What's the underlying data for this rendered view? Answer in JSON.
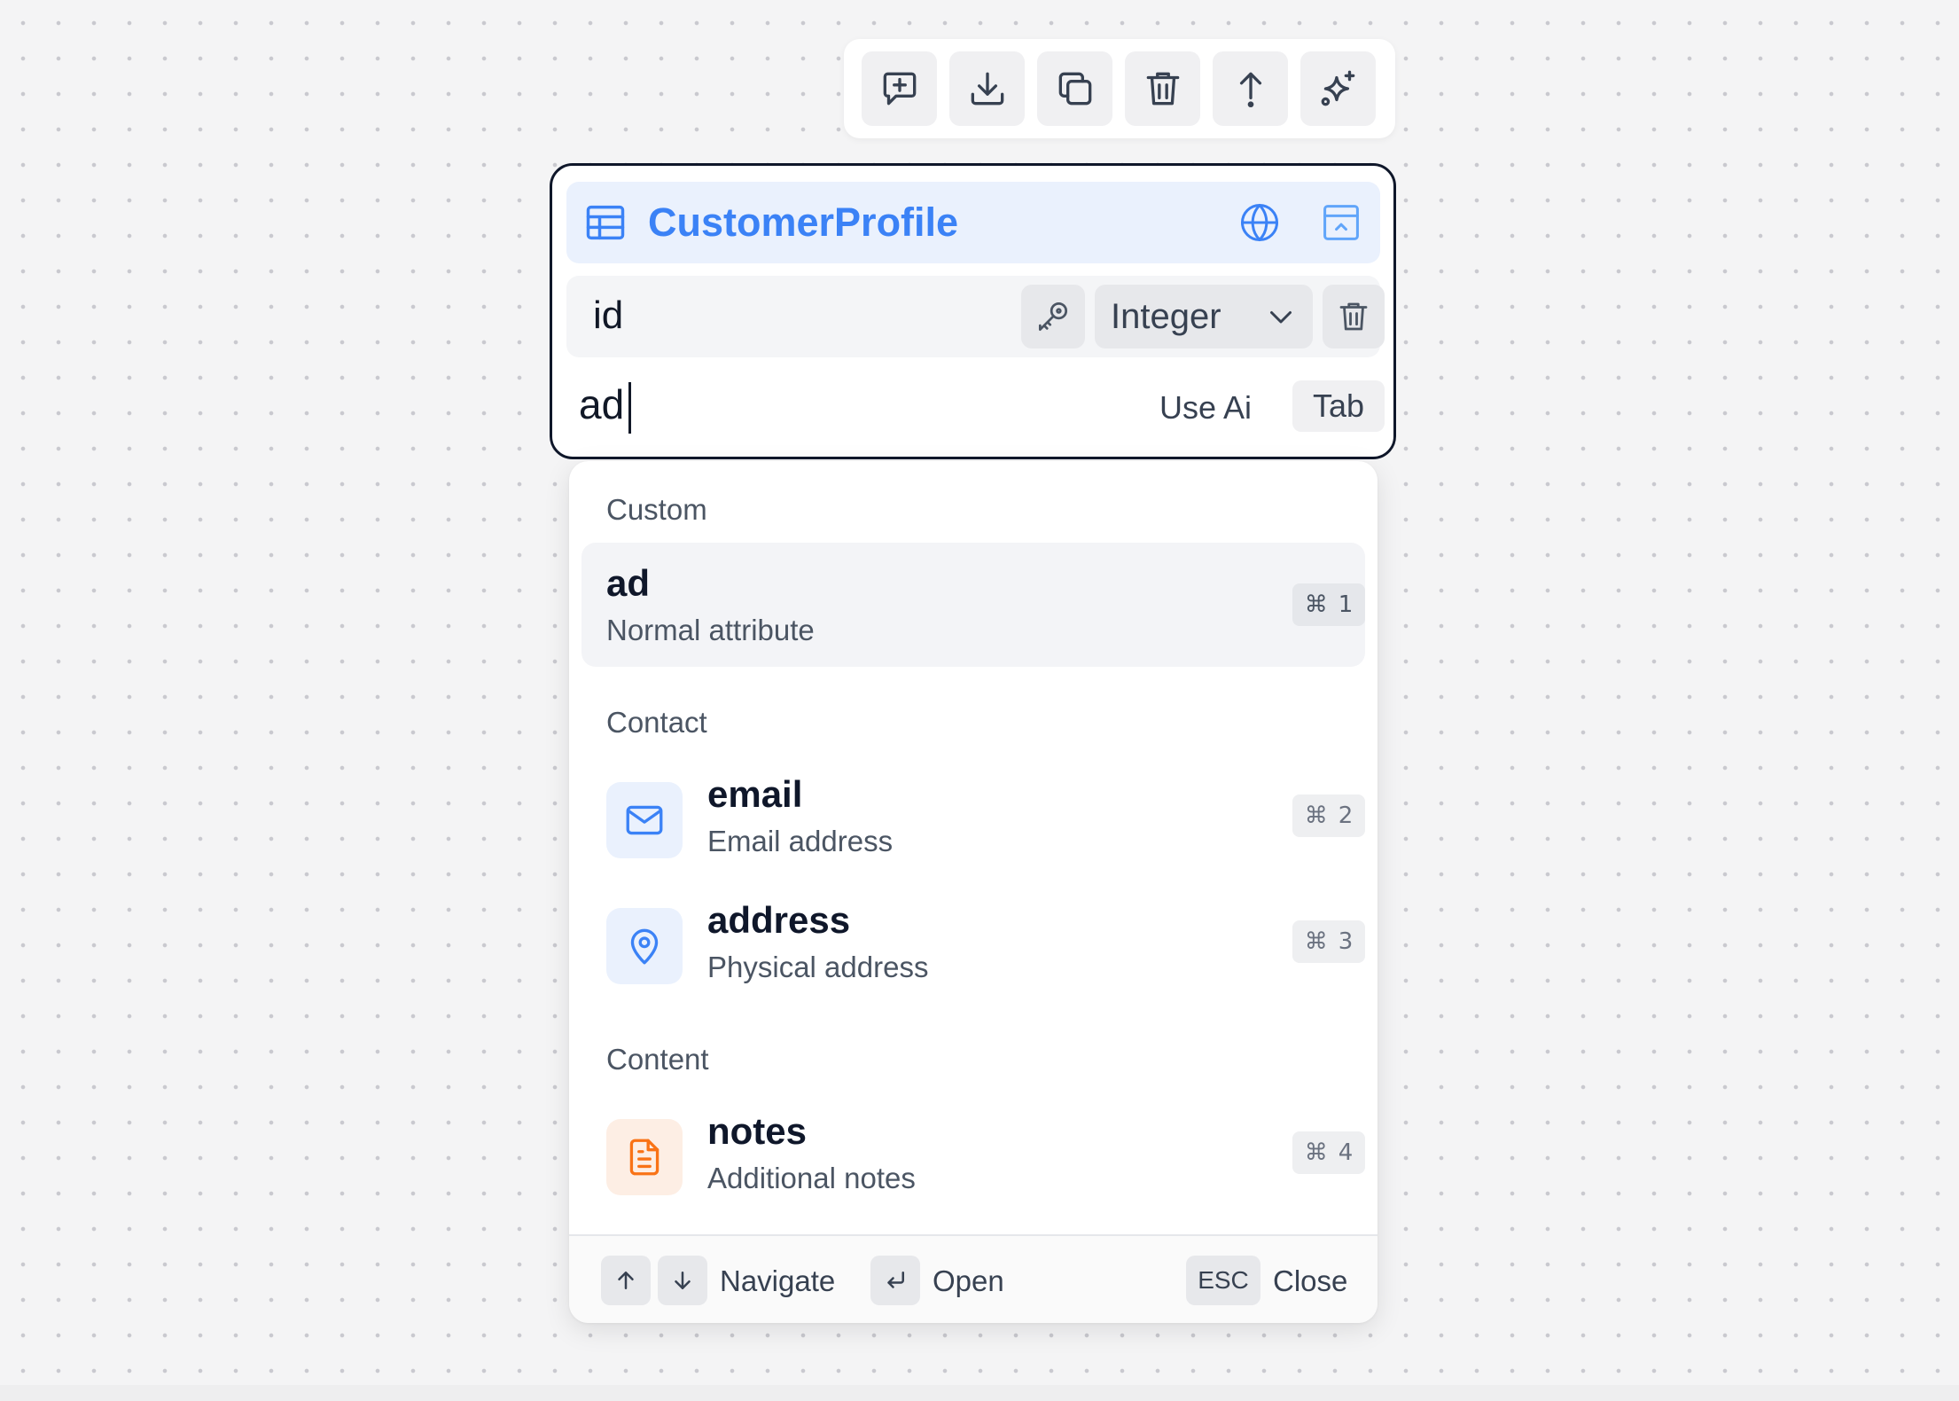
{
  "toolbar": {
    "buttons": [
      {
        "icon": "add-comment-icon"
      },
      {
        "icon": "download-icon"
      },
      {
        "icon": "copy-icon"
      },
      {
        "icon": "trash-icon"
      },
      {
        "icon": "arrow-up-icon"
      },
      {
        "icon": "sparkles-icon"
      }
    ]
  },
  "entity": {
    "title": "CustomerProfile",
    "accent_color": "#3b82f6",
    "attributes": [
      {
        "name": "id",
        "type": "Integer",
        "is_key": true
      }
    ],
    "new_attribute": {
      "value": "ad",
      "use_ai_label": "Use Ai",
      "tab_key": "Tab"
    }
  },
  "suggestions": {
    "groups": [
      {
        "label": "Custom",
        "items": [
          {
            "title": "ad",
            "subtitle": "Normal attribute",
            "shortcut_mod": "⌘",
            "shortcut_key": "1"
          }
        ]
      },
      {
        "label": "Contact",
        "items": [
          {
            "title": "email",
            "subtitle": "Email address",
            "icon": "mail-icon",
            "icon_color": "#3b82f6",
            "shortcut_mod": "⌘",
            "shortcut_key": "2"
          },
          {
            "title": "address",
            "subtitle": "Physical address",
            "icon": "map-pin-icon",
            "icon_color": "#3b82f6",
            "shortcut_mod": "⌘",
            "shortcut_key": "3"
          }
        ]
      },
      {
        "label": "Content",
        "items": [
          {
            "title": "notes",
            "subtitle": "Additional notes",
            "icon": "file-text-icon",
            "icon_color": "#f97316",
            "shortcut_mod": "⌘",
            "shortcut_key": "4"
          }
        ]
      }
    ],
    "footer": {
      "navigate_label": "Navigate",
      "open_label": "Open",
      "esc_key": "ESC",
      "close_label": "Close"
    }
  }
}
